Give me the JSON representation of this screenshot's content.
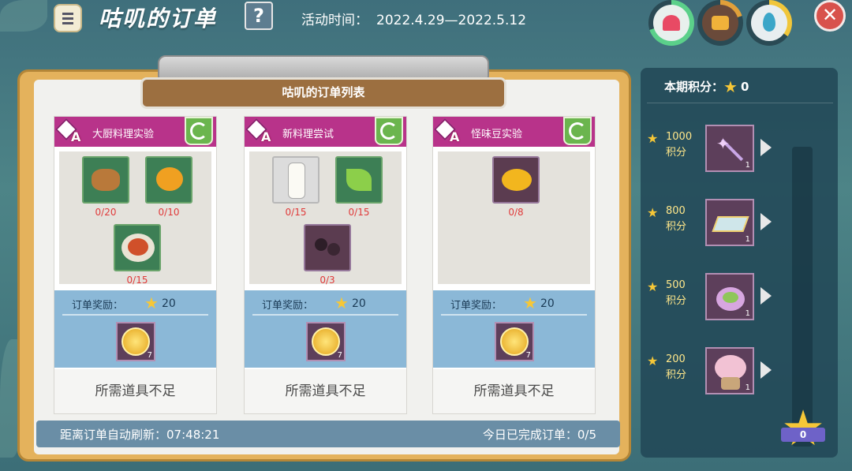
{
  "header": {
    "title": "咕叽的订单",
    "help": "?",
    "event_label": "活动时间：",
    "event_range": "2022.4.29—2022.5.12"
  },
  "colors": {
    "accent": "#b8338a",
    "refresh": "#6bb54e",
    "reward_bg": "#8bb8d7",
    "shortage": "#e03a3a",
    "gold": "#f6c737"
  },
  "board": {
    "title": "咕叽的订单列表"
  },
  "orders": [
    {
      "grade": "A",
      "name": "大厨料理实验",
      "ingredients": [
        {
          "icon": "pancake-icon",
          "count": "0/20"
        },
        {
          "icon": "pumpkin-pudding-icon",
          "count": "0/10"
        },
        {
          "icon": "pasta-icon",
          "count": "0/15"
        }
      ],
      "reward_label": "订单奖励：",
      "reward_points": "20",
      "reward_item_qty": "7",
      "action": "所需道具不足"
    },
    {
      "grade": "A",
      "name": "新料理尝试",
      "ingredients": [
        {
          "icon": "milk-bottle-icon",
          "count": "0/15"
        },
        {
          "icon": "mint-leaf-icon",
          "count": "0/15"
        },
        {
          "icon": "dark-berries-icon",
          "count": "0/3"
        }
      ],
      "reward_label": "订单奖励：",
      "reward_points": "20",
      "reward_item_qty": "7",
      "action": "所需道具不足"
    },
    {
      "grade": "A",
      "name": "怪味豆实验",
      "ingredients": [
        {
          "icon": "golden-bean-icon",
          "count": "0/8"
        }
      ],
      "reward_label": "订单奖励：",
      "reward_points": "20",
      "reward_item_qty": "7",
      "action": "所需道具不足"
    }
  ],
  "status": {
    "refresh_label": "距离订单自动刷新：",
    "refresh_time": "07:48:21",
    "completed_label": "今日已完成订单：",
    "completed_value": "0/5"
  },
  "points_panel": {
    "label": "本期积分：",
    "value": "0",
    "tiers": [
      {
        "points": "1000",
        "unit": "积分",
        "icon": "star-wand-icon",
        "qty": "1"
      },
      {
        "points": "800",
        "unit": "积分",
        "icon": "crystal-mat-icon",
        "qty": "1"
      },
      {
        "points": "500",
        "unit": "积分",
        "icon": "flower-basket-icon",
        "qty": "1"
      },
      {
        "points": "200",
        "unit": "积分",
        "icon": "blossom-tree-icon",
        "qty": "1"
      }
    ],
    "score_badge": "0"
  }
}
